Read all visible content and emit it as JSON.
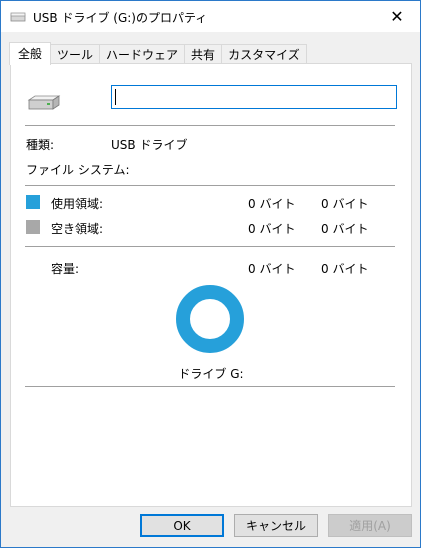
{
  "window": {
    "title": "USB ドライブ (G:)のプロパティ",
    "close_glyph": "✕"
  },
  "tabs": [
    {
      "label": "全般",
      "active": true
    },
    {
      "label": "ツール",
      "active": false
    },
    {
      "label": "ハードウェア",
      "active": false
    },
    {
      "label": "共有",
      "active": false
    },
    {
      "label": "カスタマイズ",
      "active": false
    }
  ],
  "general": {
    "name_value": "",
    "type_label": "種類:",
    "type_value": "USB ドライブ",
    "filesystem_label": "ファイル システム:",
    "used_label": "使用領域:",
    "used_value1": "0 バイト",
    "used_value2": "0 バイト",
    "free_label": "空き領域:",
    "free_value1": "0 バイト",
    "free_value2": "0 バイト",
    "capacity_label": "容量:",
    "capacity_value1": "0 バイト",
    "capacity_value2": "0 バイト",
    "drive_label": "ドライブ G:",
    "used_color": "#26a0da",
    "free_color": "#a8a8a8"
  },
  "footer": {
    "ok_label": "OK",
    "cancel_label": "キャンセル",
    "apply_label": "適用(A)"
  }
}
